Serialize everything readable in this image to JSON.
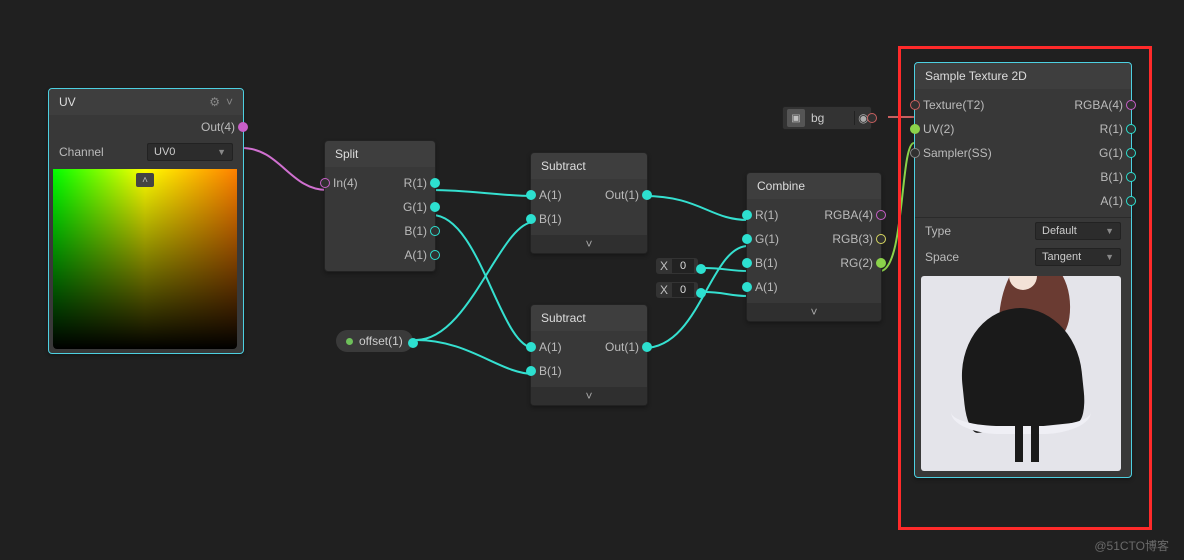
{
  "watermark": "@51CTO博客",
  "bg_chip": {
    "label": "bg",
    "icon": "▣"
  },
  "offset_pill": {
    "label": "offset(1)"
  },
  "float_inputs": {
    "x0": "X",
    "v0": "0",
    "x1": "X",
    "v1": "0"
  },
  "nodes": {
    "uv": {
      "title": "UV",
      "out": "Out(4)",
      "channel_label": "Channel",
      "channel_value": "UV0"
    },
    "split": {
      "title": "Split",
      "in": "In(4)",
      "r": "R(1)",
      "g": "G(1)",
      "b": "B(1)",
      "a": "A(1)"
    },
    "sub1": {
      "title": "Subtract",
      "a": "A(1)",
      "b": "B(1)",
      "out": "Out(1)"
    },
    "sub2": {
      "title": "Subtract",
      "a": "A(1)",
      "b": "B(1)",
      "out": "Out(1)"
    },
    "combine": {
      "title": "Combine",
      "r": "R(1)",
      "g": "G(1)",
      "b": "B(1)",
      "a": "A(1)",
      "rgba": "RGBA(4)",
      "rgb": "RGB(3)",
      "rg": "RG(2)"
    },
    "sample": {
      "title": "Sample Texture 2D",
      "tex": "Texture(T2)",
      "uv": "UV(2)",
      "ss": "Sampler(SS)",
      "rgba": "RGBA(4)",
      "r": "R(1)",
      "g": "G(1)",
      "b": "B(1)",
      "a": "A(1)",
      "type_label": "Type",
      "type_value": "Default",
      "space_label": "Space",
      "space_value": "Tangent"
    }
  }
}
